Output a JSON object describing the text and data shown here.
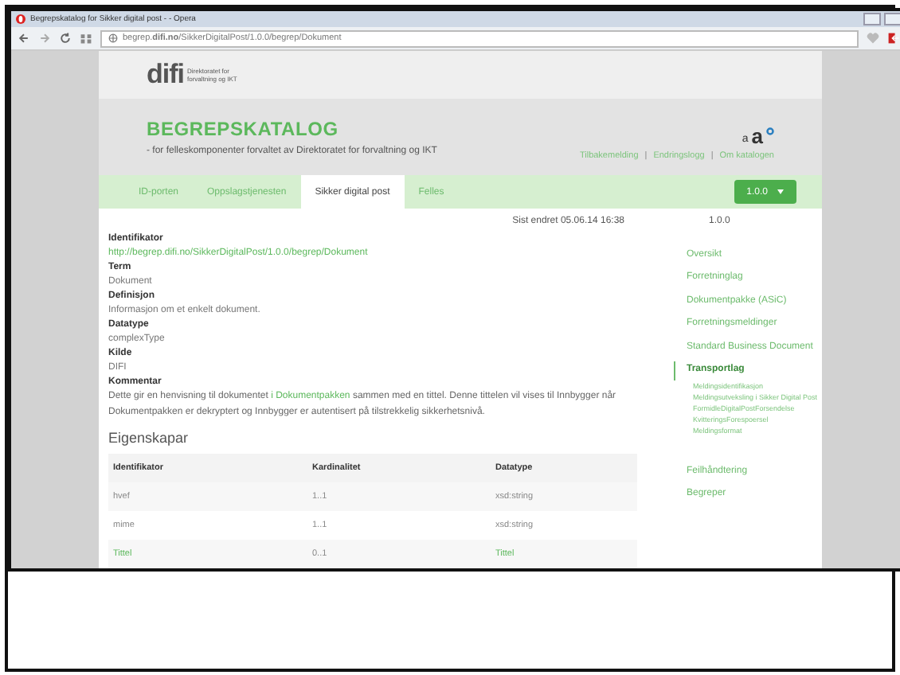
{
  "browser": {
    "tab_title": "Begrepskatalog for Sikker digital post - - Opera",
    "url": "begrep.**difi.no**/SikkerDigitalPost/1.0.0/begrep/Dokument"
  },
  "logo": {
    "mark": "difi",
    "caption": "Direktoratet for forvaltning og IKT"
  },
  "header": {
    "title": "BEGREPSKATALOG",
    "subtitle": "- for felleskomponenter forvaltet av Direktoratet for forvaltning og IKT",
    "font_small": "a",
    "font_large": "a",
    "links": [
      "Tilbakemelding",
      "Endringslogg",
      "Om katalogen"
    ],
    "link_separator": "|"
  },
  "tabs": [
    {
      "label": "ID-porten",
      "selected": false
    },
    {
      "label": "Oppslagstjenesten",
      "selected": false
    },
    {
      "label": "Sikker digital post",
      "selected": true
    },
    {
      "label": "Felles",
      "selected": false
    }
  ],
  "version_button": "1.0.0",
  "meta": {
    "changed": "Sist endret 05.06.14 16:38",
    "version": "1.0.0"
  },
  "fields": [
    {
      "label": "Identifikator",
      "value": "http://begrep.difi.no/SikkerDigitalPost/1.0.0/begrep/Dokument",
      "link": true
    },
    {
      "label": "Term",
      "value": "Dokument",
      "link": false
    },
    {
      "label": "Definisjon",
      "value": "Informasjon om et enkelt dokument.",
      "link": false
    },
    {
      "label": "Datatype",
      "value": "complexType",
      "link": false
    },
    {
      "label": "Kilde",
      "value": "DIFI",
      "link": false
    }
  ],
  "comment": {
    "label": "Kommentar",
    "before": "Dette gir en henvisning til dokumentet",
    "link": "i Dokumentpakken",
    "after": "sammen med en tittel. Denne tittelen vil vises til Innbygger når Dokumentpakken er dekryptert og Innbygger er autentisert på tilstrekkelig sikkerhetsnivå."
  },
  "properties": {
    "title": "Eigenskapar",
    "columns": [
      "Identifikator",
      "Kardinalitet",
      "Datatype"
    ],
    "rows": [
      [
        {
          "text": "hvef",
          "link": false
        },
        {
          "text": "1..1",
          "link": false
        },
        {
          "text": "xsd:string",
          "link": false
        }
      ],
      [
        {
          "text": "mime",
          "link": false
        },
        {
          "text": "1..1",
          "link": false
        },
        {
          "text": "xsd:string",
          "link": false
        }
      ],
      [
        {
          "text": "Tittel",
          "link": true
        },
        {
          "text": "0..1",
          "link": false
        },
        {
          "text": "Tittel",
          "link": true
        }
      ]
    ]
  },
  "side_nav": [
    {
      "label": "Oversikt",
      "selected": false
    },
    {
      "label": "Forretninglag",
      "selected": false
    },
    {
      "label": "Dokumentpakke (ASiC)",
      "selected": false
    },
    {
      "label": "Forretningsmeldinger",
      "selected": false
    },
    {
      "label": "Standard Business Document",
      "selected": false
    },
    {
      "label": "Transportlag",
      "selected": true,
      "children": [
        {
          "label": "Meldingsidentifikasjon"
        },
        {
          "label": "Meldingsutveksling i Sikker Digital Post"
        },
        {
          "label": "FormidleDigitalPostForsendelse"
        },
        {
          "label": "KvitteringsForespoersel"
        },
        {
          "label": "Meldingsformat"
        }
      ]
    },
    {
      "label": "Feilhåndtering",
      "selected": false
    },
    {
      "label": "Begreper",
      "selected": false
    }
  ]
}
